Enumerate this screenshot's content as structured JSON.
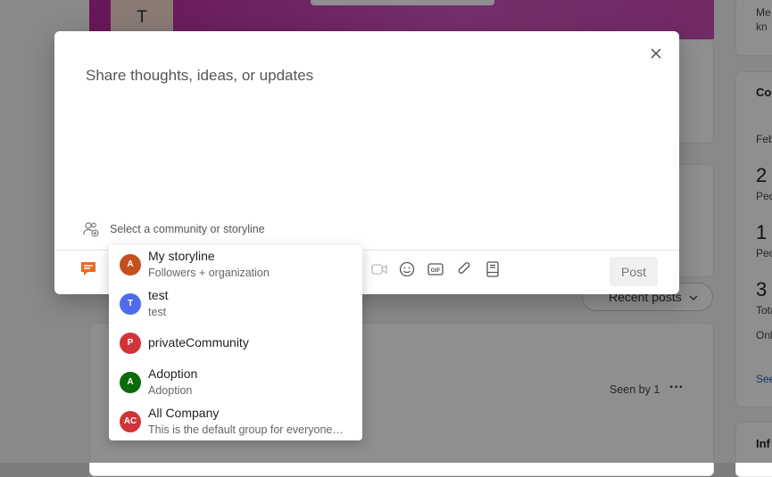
{
  "background": {
    "banner_avatar_letter": "T",
    "right_panel": {
      "top_text_1": "Me",
      "top_text_2": "kn",
      "section_title": "Co",
      "date_label": "Feb",
      "stat_1_value": "2",
      "stat_1_label": "Peo",
      "stat_2_value": "1",
      "stat_2_label": "Peo",
      "stat_3_value": "3",
      "stat_3_label": "Tota",
      "stat_3_sub": "Onl",
      "see_link": "See",
      "info_title": "Inf"
    },
    "sort_dropdown_label": "Recent posts",
    "seen_by_label": "Seen by 1",
    "more_label": "···"
  },
  "composer": {
    "placeholder": "Share thoughts, ideas, or updates",
    "community_selector_label": "Select a community or storyline",
    "post_button_label": "Post"
  },
  "community_dropdown": {
    "items": [
      {
        "initials": "A",
        "title": "My storyline",
        "subtitle": "Followers + organization",
        "color": "#c4501f"
      },
      {
        "initials": "T",
        "title": "test",
        "subtitle": "test",
        "color": "#4f6bed"
      },
      {
        "initials": "P",
        "title": "privateCommunity",
        "subtitle": "",
        "color": "#d13438"
      },
      {
        "initials": "A",
        "title": "Adoption",
        "subtitle": "Adoption",
        "color": "#0b6a0b"
      },
      {
        "initials": "AC",
        "title": "All Company",
        "subtitle": "This is the default group for everyone i...",
        "color": "#d13438"
      }
    ]
  },
  "colors": {
    "accent_orange": "#e66c1f",
    "icon_gray": "#666666"
  }
}
